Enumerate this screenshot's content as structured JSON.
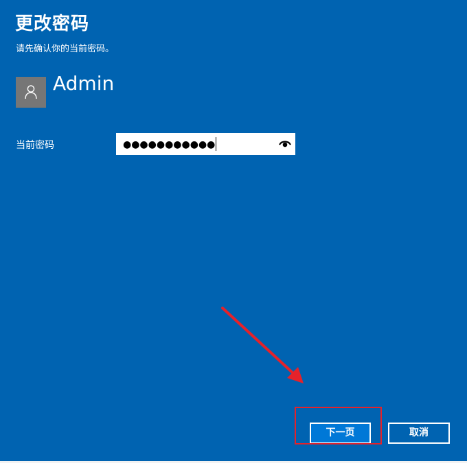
{
  "dialog": {
    "title": "更改密码",
    "subtitle": "请先确认你的当前密码。",
    "user": {
      "avatar_icon": "user-icon",
      "name": "Admin"
    },
    "current_password": {
      "label": "当前密码",
      "masked_value": "●●●●●●●●●●●",
      "reveal_icon": "eye-icon"
    },
    "buttons": {
      "next_label": "下一页",
      "cancel_label": "取消"
    }
  },
  "annotation": {
    "arrow_color": "#e5222a",
    "highlight_color": "#e5222a"
  },
  "colors": {
    "background": "#0063b1",
    "accent_button": "#0078d7",
    "avatar": "#767676"
  }
}
